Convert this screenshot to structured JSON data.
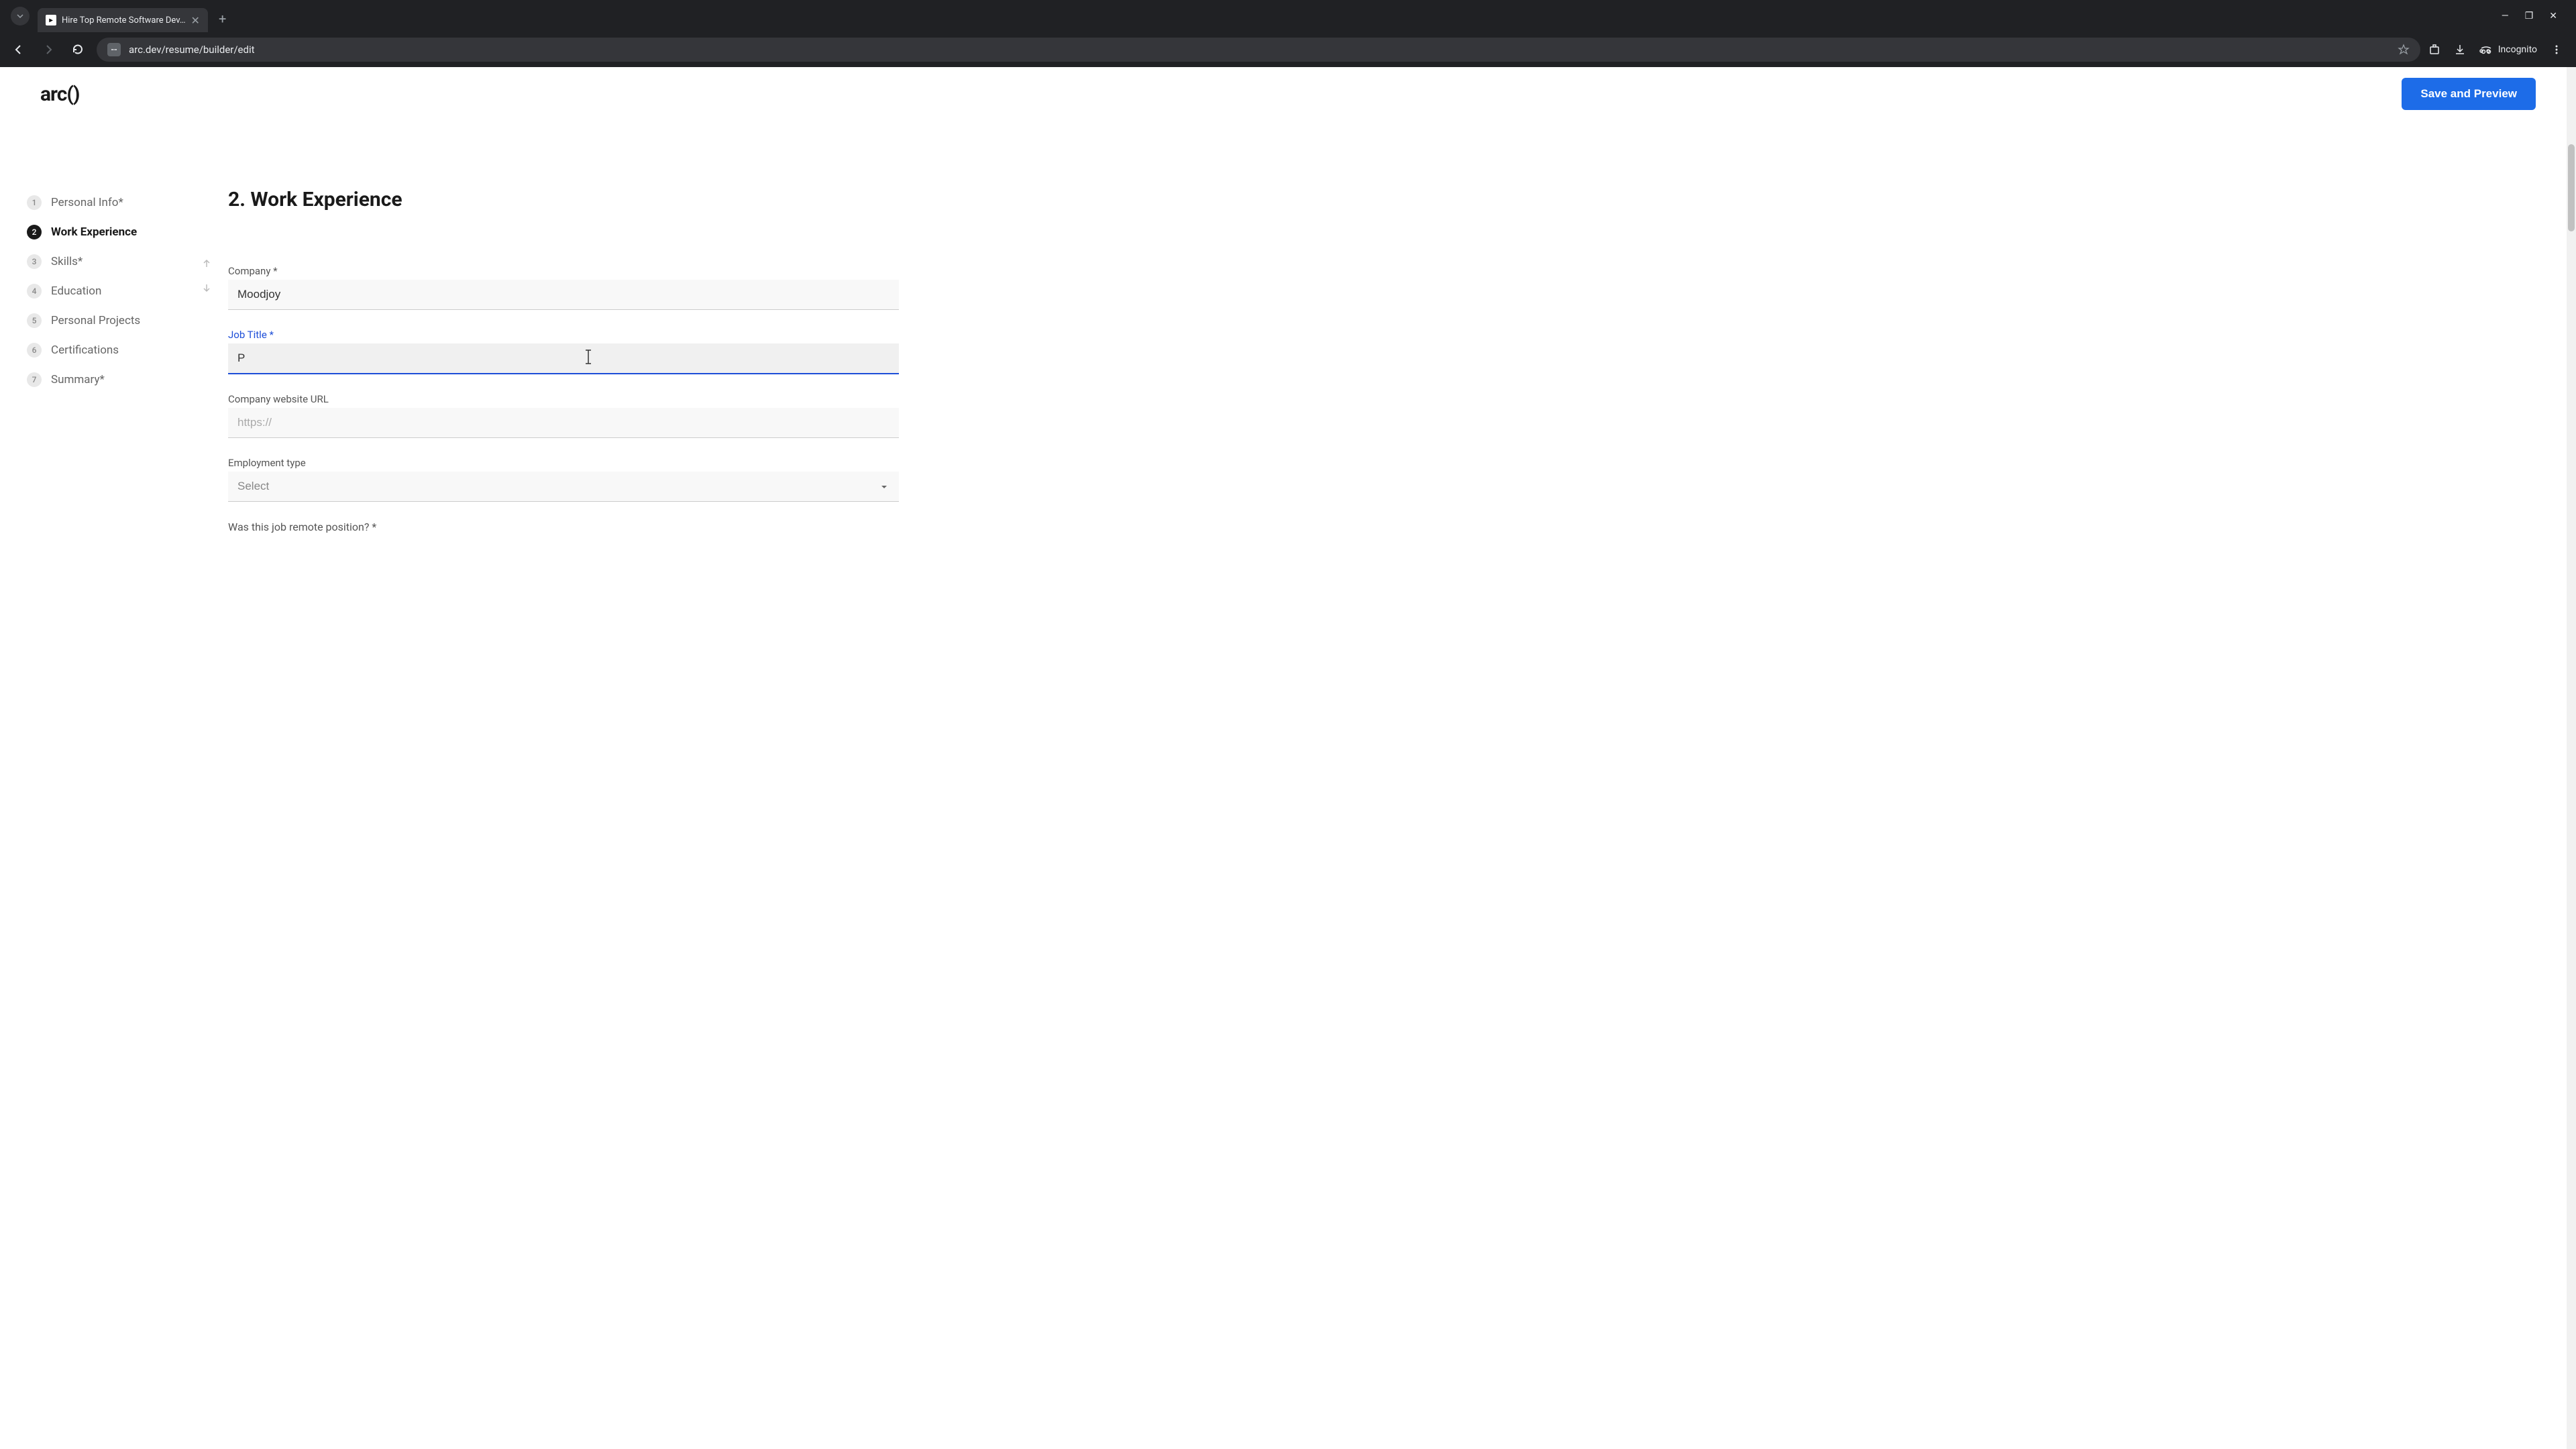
{
  "browser": {
    "tab_title": "Hire Top Remote Software Dev…",
    "url": "arc.dev/resume/builder/edit",
    "incognito_label": "Incognito"
  },
  "header": {
    "logo_text": "arc()",
    "save_button": "Save and Preview"
  },
  "sidebar": {
    "items": [
      {
        "num": "1",
        "label": "Personal Info*"
      },
      {
        "num": "2",
        "label": "Work Experience"
      },
      {
        "num": "3",
        "label": "Skills*"
      },
      {
        "num": "4",
        "label": "Education"
      },
      {
        "num": "5",
        "label": "Personal Projects"
      },
      {
        "num": "6",
        "label": "Certifications"
      },
      {
        "num": "7",
        "label": "Summary*"
      }
    ]
  },
  "form": {
    "section_title": "2. Work Experience",
    "company_label": "Company *",
    "company_value": "Moodjoy",
    "job_title_label": "Job Title *",
    "job_title_value": "P",
    "website_label": "Company website URL",
    "website_placeholder": "https://",
    "employment_label": "Employment type",
    "employment_placeholder": "Select",
    "remote_question": "Was this job remote position? *"
  }
}
